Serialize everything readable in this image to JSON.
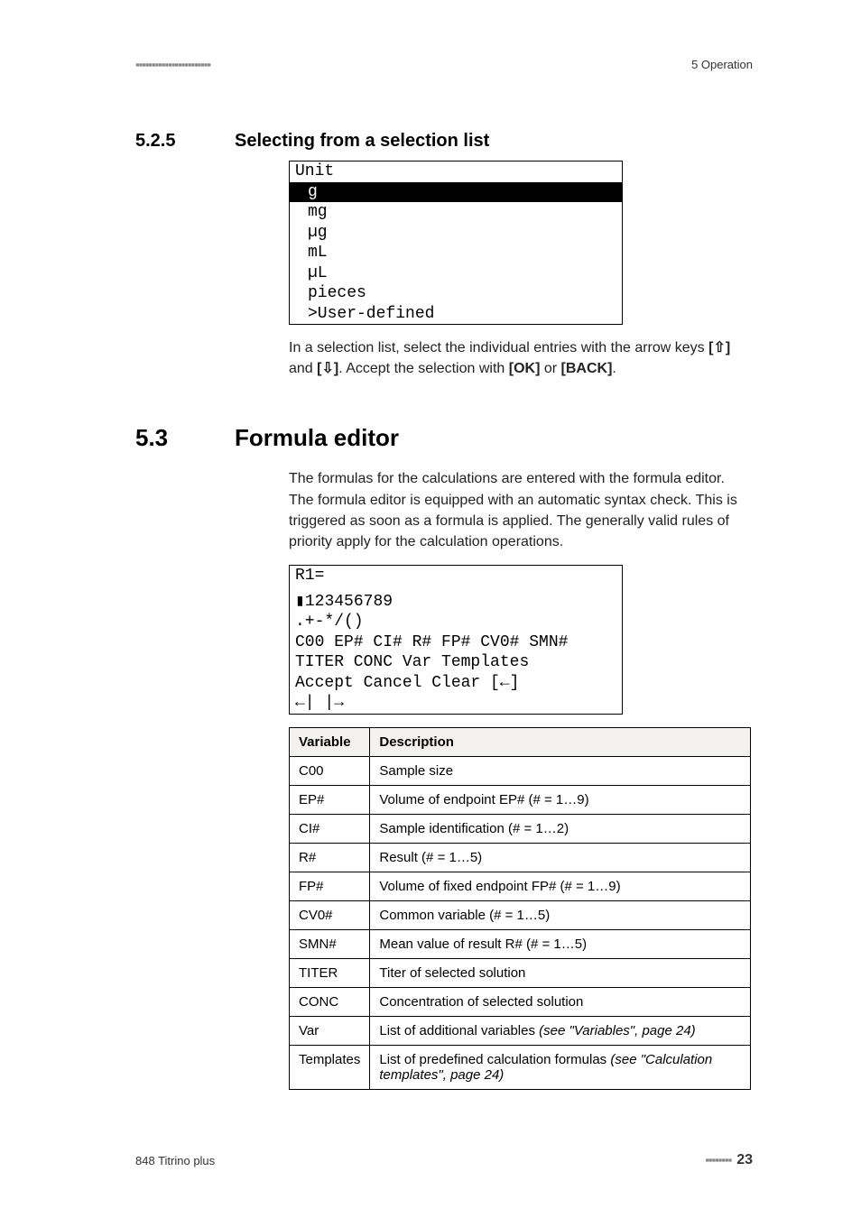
{
  "header": {
    "left_bars": "▪▪▪▪▪▪▪▪▪▪▪▪▪▪▪▪▪▪▪▪▪▪▪",
    "breadcrumb": "5 Operation"
  },
  "section_525": {
    "number": "5.2.5",
    "title": "Selecting from a selection list",
    "screenshot": {
      "title": "Unit",
      "selected": "g",
      "rows": [
        "mg",
        "µg",
        "mL",
        "µL",
        "pieces",
        ">User-defined"
      ]
    },
    "caption_parts": {
      "p1": "In a selection list, select the individual entries with the arrow keys ",
      "k1": "[⇧]",
      "p2": " and ",
      "k2": "[⇩]",
      "p3": ". Accept the selection with ",
      "k3": "[OK]",
      "p4": " or ",
      "k4": "[BACK]",
      "p5": "."
    }
  },
  "section_53": {
    "number": "5.3",
    "title": "Formula editor",
    "intro": "The formulas for the calculations are entered with the formula editor. The formula editor is equipped with an automatic syntax check. This is triggered as soon as a formula is applied. The generally valid rules of priority apply for the calculation operations.",
    "editor": {
      "title": "R1=",
      "selected_blank": " ",
      "lines": [
        "▮123456789",
        ".+-*/()",
        "C00 EP# CI# R# FP# CV0# SMN#",
        "TITER CONC Var Templates",
        "Accept Cancel Clear [←]",
        "←| |→"
      ]
    },
    "table": {
      "header": {
        "c1": "Variable",
        "c2": "Description"
      },
      "rows": [
        {
          "v": "C00",
          "d": "Sample size"
        },
        {
          "v": "EP#",
          "d": "Volume of endpoint EP# (# = 1…9)"
        },
        {
          "v": "CI#",
          "d": "Sample identification (# = 1…2)"
        },
        {
          "v": "R#",
          "d": "Result (# = 1…5)"
        },
        {
          "v": "FP#",
          "d": "Volume of fixed endpoint FP# (# = 1…9)"
        },
        {
          "v": "CV0#",
          "d": "Common variable (# = 1…5)"
        },
        {
          "v": "SMN#",
          "d": "Mean value of result R# (# = 1…5)"
        },
        {
          "v": "TITER",
          "d": "Titer of selected solution"
        },
        {
          "v": "CONC",
          "d": "Concentration of selected solution"
        },
        {
          "v": "Var",
          "d_pre": "List of additional variables ",
          "d_em": "(see \"Variables\", page 24)"
        },
        {
          "v": "Templates",
          "d_pre": "List of predefined calculation formulas ",
          "d_em": "(see \"Calculation templates\", page 24)"
        }
      ]
    }
  },
  "footer": {
    "product": "848 Titrino plus",
    "bars_right": "▪▪▪▪▪▪▪▪",
    "page": "23"
  }
}
